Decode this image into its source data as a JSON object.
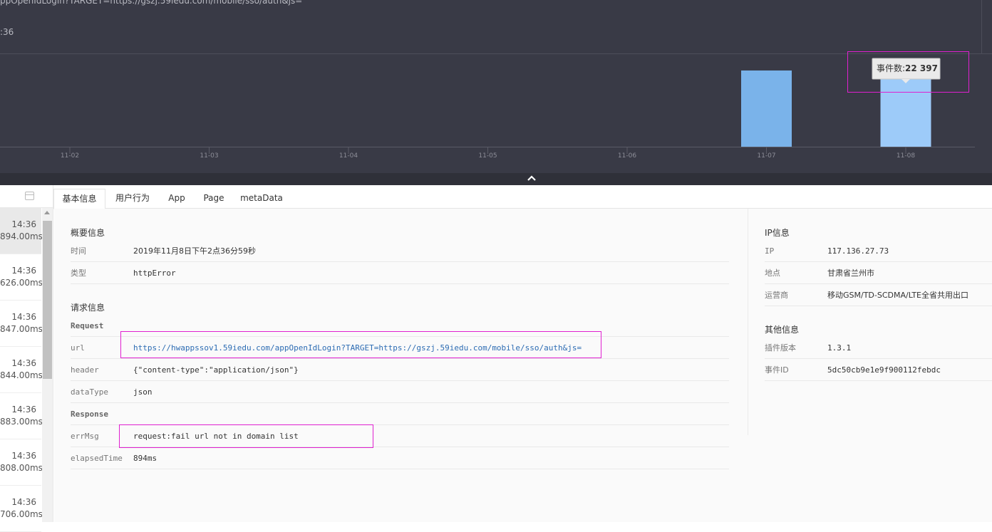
{
  "top": {
    "url_line": "ppOpenIdLogin?TARGET=https://gszj.59iedu.com/mobile/sso/auth&js=",
    "time_fragment": ":36"
  },
  "chart_data": {
    "type": "bar",
    "categories": [
      "11-02",
      "11-03",
      "11-04",
      "11-05",
      "11-06",
      "11-07",
      "11-08"
    ],
    "series": [
      {
        "values": [
          0,
          0,
          0,
          0,
          0,
          24700,
          22397
        ]
      }
    ],
    "colors": [
      "#7ab3ea",
      "#9dcbf9"
    ],
    "tooltip": {
      "label": "事件数:",
      "value": "22 397"
    }
  },
  "collapse_icon": "chevron-up-icon",
  "list": {
    "items": [
      {
        "time": "14:36",
        "duration": "894.00ms",
        "active": true
      },
      {
        "time": "14:36",
        "duration": "626.00ms"
      },
      {
        "time": "14:36",
        "duration": "847.00ms"
      },
      {
        "time": "14:36",
        "duration": "844.00ms"
      },
      {
        "time": "14:36",
        "duration": "883.00ms"
      },
      {
        "time": "14:36",
        "duration": "808.00ms"
      },
      {
        "time": "14:36",
        "duration": "706.00ms"
      }
    ]
  },
  "tabs": [
    {
      "label": "基本信息",
      "active": true
    },
    {
      "label": "用户行为"
    },
    {
      "label": "App"
    },
    {
      "label": "Page"
    },
    {
      "label": "metaData"
    }
  ],
  "overview": {
    "title": "概要信息",
    "time_label": "时间",
    "time_value": "2019年11月8日下午2点36分59秒",
    "type_label": "类型",
    "type_value": "httpError"
  },
  "request": {
    "title": "请求信息",
    "request_label": "Request",
    "url_label": "url",
    "url_value": "https://hwappssov1.59iedu.com/appOpenIdLogin?TARGET=https://gszj.59iedu.com/mobile/sso/auth&js=",
    "header_label": "header",
    "header_value": "{\"content-type\":\"application/json\"}",
    "datatype_label": "dataType",
    "datatype_value": "json",
    "response_label": "Response",
    "errmsg_label": "errMsg",
    "errmsg_value": "request:fail url not in domain list",
    "elapsed_label": "elapsedTime",
    "elapsed_value": "894ms"
  },
  "ip": {
    "title": "IP信息",
    "ip_label": "IP",
    "ip_value": "117.136.27.73",
    "location_label": "地点",
    "location_value": "甘肃省兰州市",
    "carrier_label": "运营商",
    "carrier_value": "移动GSM/TD-SCDMA/LTE全省共用出口"
  },
  "other": {
    "title": "其他信息",
    "plugin_label": "插件版本",
    "plugin_value": "1.3.1",
    "eventid_label": "事件ID",
    "eventid_value": "5dc50cb9e1e9f900112febdc"
  }
}
